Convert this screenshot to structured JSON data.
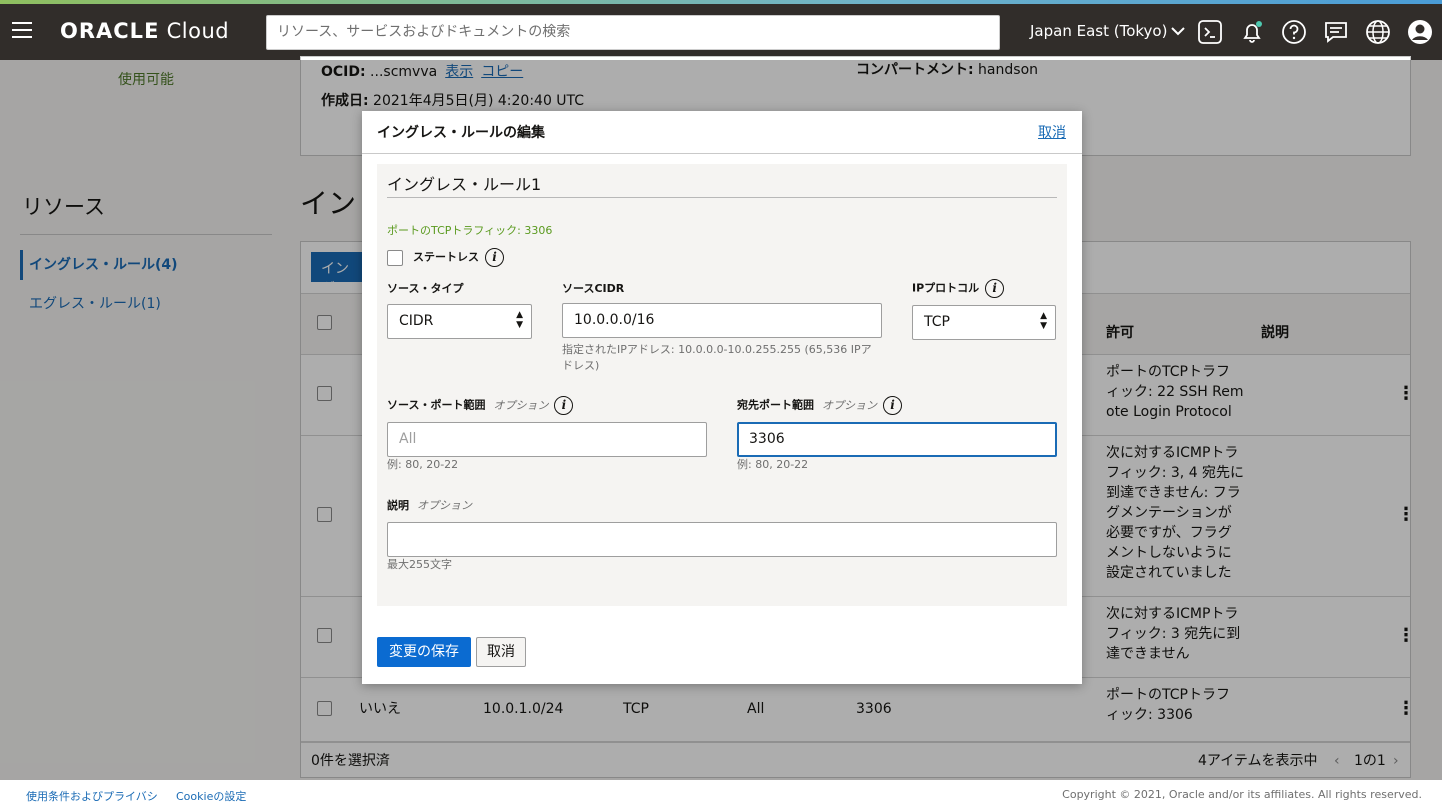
{
  "header": {
    "logo_bold": "ORACLE",
    "logo_rest": " Cloud",
    "search_placeholder": "リソース、サービスおよびドキュメントの検索",
    "region": "Japan East (Tokyo)",
    "icons": [
      "cloud-shell-icon",
      "bell-icon",
      "help-icon",
      "chat-icon",
      "globe-icon",
      "user-icon"
    ]
  },
  "page": {
    "status": "使用可能",
    "ocid_label": "OCID:",
    "ocid_value": " ...scmvva",
    "ocid_show": "表示",
    "ocid_copy": "コピー",
    "created_label": "作成日:",
    "created_value": " 2021年4月5日(月) 4:20:40 UTC",
    "compartment_label": "コンパートメント:",
    "compartment_value": " handson",
    "resources_title": "リソース",
    "resources": [
      "イングレス・ルール(4)",
      "エグレス・ルール(1)"
    ],
    "section_title": "イン",
    "toolbar_button": "イング",
    "columns": {
      "allow": "許可",
      "desc": "説明"
    },
    "rows": [
      {
        "allow": [
          "ポートのTCPトラフ",
          "ィック: 22 SSH Rem",
          "ote Login Protocol"
        ]
      },
      {
        "allow": [
          "次に対するICMPトラ",
          "フィック: 3, 4 宛先に",
          "到達できません: フラ",
          "グメンテーションが",
          "必要ですが、フラグ",
          "メントしないように",
          "設定されていました"
        ]
      },
      {
        "allow": [
          "次に対するICMPトラ",
          "フィック: 3 宛先に到",
          "達できません"
        ]
      },
      {
        "stateless": "いいえ",
        "source": "10.0.1.0/24",
        "protocol": "TCP",
        "src_port": "All",
        "dst_port": "3306",
        "allow": [
          "ポートのTCPトラフ",
          "ィック: 3306"
        ]
      }
    ],
    "selected_count": "0件を選択済",
    "showing": "4アイテムを表示中",
    "pagination": "1の1"
  },
  "modal": {
    "title": "イングレス・ルールの編集",
    "cancel_link": "取消",
    "rule_title": "イングレス・ルール1",
    "traffic_note": "ポートのTCPトラフィック: 3306",
    "stateless_label": "ステートレス",
    "source_type_label": "ソース・タイプ",
    "source_type_value": "CIDR",
    "source_cidr_label": "ソースCIDR",
    "source_cidr_value": "10.0.0.0/16",
    "source_cidr_hint": "指定されたIPアドレス: 10.0.0.0-10.0.255.255 (65,536 IPアドレス)",
    "ip_protocol_label": "IPプロトコル",
    "ip_protocol_value": "TCP",
    "source_port_label": "ソース・ポート範囲",
    "optional": "オプション",
    "source_port_placeholder": "All",
    "source_port_hint": "例: 80, 20-22",
    "dest_port_label": "宛先ポート範囲",
    "dest_port_value": "3306",
    "dest_port_hint": "例: 80, 20-22",
    "description_label": "説明",
    "description_hint": "最大255文字",
    "save_button": "変更の保存",
    "cancel_button": "取消"
  },
  "footer": {
    "terms": "使用条件およびプライバシ",
    "cookie": "Cookieの設定",
    "copyright": "Copyright © 2021, Oracle and/or its affiliates. All rights reserved."
  }
}
